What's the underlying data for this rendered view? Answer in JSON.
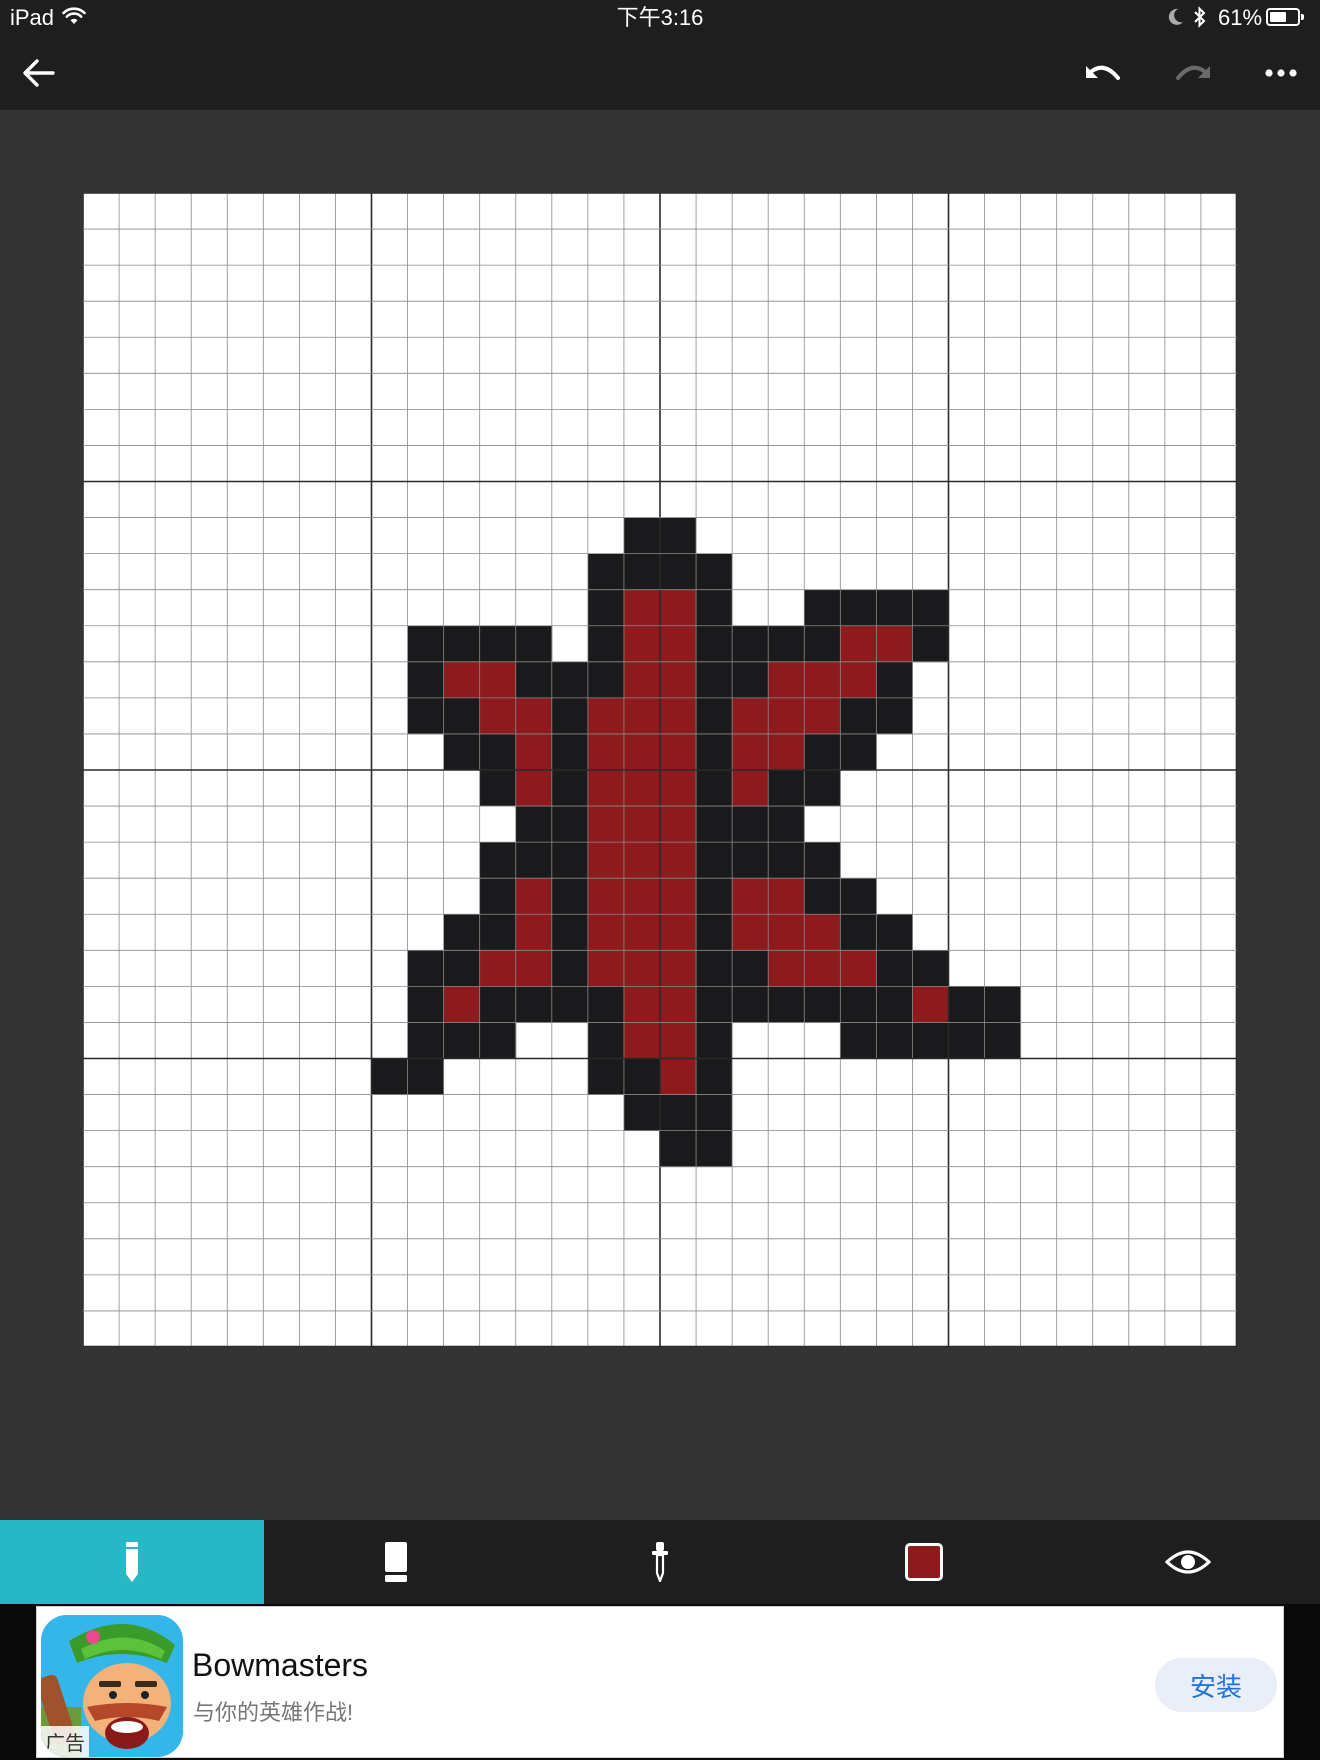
{
  "status_bar": {
    "device": "iPad",
    "time": "下午3:16",
    "battery": "61%",
    "battery_level": 0.61,
    "icons": [
      "wifi-icon",
      "moon-icon",
      "bluetooth-icon",
      "battery-icon"
    ]
  },
  "nav": {
    "icons": [
      "back-arrow-icon",
      "undo-icon",
      "redo-icon",
      "more-icon"
    ],
    "redo_enabled": false
  },
  "canvas": {
    "columns": 32,
    "rows": 32,
    "major_every": 8,
    "palette": {
      "W": "#ffffff",
      "B": "#1a1a1c",
      "R": "#8d1b1d"
    },
    "pixels": [
      "WWWWWWWWWWWWWWWWWWWWWWWWWWWWWWWW",
      "WWWWWWWWWWWWWWWWWWWWWWWWWWWWWWWW",
      "WWWWWWWWWWWWWWWWWWWWWWWWWWWWWWWW",
      "WWWWWWWWWWWWWWWWWWWWWWWWWWWWWWWW",
      "WWWWWWWWWWWWWWWWWWWWWWWWWWWWWWWW",
      "WWWWWWWWWWWWWWWWWWWWWWWWWWWWWWWW",
      "WWWWWWWWWWWWWWWWWWWWWWWWWWWWWWWW",
      "WWWWWWWWWWWWWWWWWWWWWWWWWWWWWWWW",
      "WWWWWWWWWWWWWWWWWWWWWWWWWWWWWWWW",
      "WWWWWWWWWWWWWWWBBWWWWWWWWWWWWWWW",
      "WWWWWWWWWWWWWWBBBBWWWWWWWWWWWWWW",
      "WWWWWWWWWWWWWWBRRBWWBBBBWWWWWWWW",
      "WWWWWWWWWBBBBWBRRBBBBRRBWWWWWWWW",
      "WWWWWWWWWBRRBBBRRBBRRRBWWWWWWWWW",
      "WWWWWWWWWBBRRBRRRBRRRBBWWWWWWWWW",
      "WWWWWWWWWWBBRBRRRBRRBBWWWWWWWWWW",
      "WWWWWWWWWWWBRBRRRBRBBWWWWWWWWWWW",
      "WWWWWWWWWWWWBBRRRBBBWWWWWWWWWWWW",
      "WWWWWWWWWWWBBBRRRBBBBWWWWWWWWWWW",
      "WWWWWWWWWWWBRBRRRBRRBBWWWWWWWWWW",
      "WWWWWWWWWWBBRBRRRBRRRBBWWWWWWWWW",
      "WWWWWWWWWBBRRBRRRBBRRRBBWWWWWWWW",
      "WWWWWWWWWBRBBBBRRBBBBBBRBBWWWWWW",
      "WWWWWWWWWBBBWWBRRBWWWBBBBBWWWWWW",
      "WWWWWWWWBBWWWWBBRBWWWWWWWWWWWWWW",
      "WWWWWWWWWWWWWWWBBBWWWWWWWWWWWWWW",
      "WWWWWWWWWWWWWWWWBBWWWWWWWWWWWWWW",
      "WWWWWWWWWWWWWWWWWWWWWWWWWWWWWWWW",
      "WWWWWWWWWWWWWWWWWWWWWWWWWWWWWWWW",
      "WWWWWWWWWWWWWWWWWWWWWWWWWWWWWWWW",
      "WWWWWWWWWWWWWWWWWWWWWWWWWWWWWWWW",
      "WWWWWWWWWWWWWWWWWWWWWWWWWWWWWWWW"
    ]
  },
  "toolbar": {
    "tools": [
      {
        "icon": "pencil-icon",
        "active": true
      },
      {
        "icon": "eraser-icon",
        "active": false
      },
      {
        "icon": "eyedropper-icon",
        "active": false
      },
      {
        "icon": "color-swatch-icon",
        "active": false
      },
      {
        "icon": "eye-icon",
        "active": false
      }
    ],
    "current_color": "#8d1b1d",
    "active_color": "#27b8c6"
  },
  "ad": {
    "title": "Bowmasters",
    "subtitle": "与你的英雄作战!",
    "label": "广告",
    "install": "安装"
  }
}
